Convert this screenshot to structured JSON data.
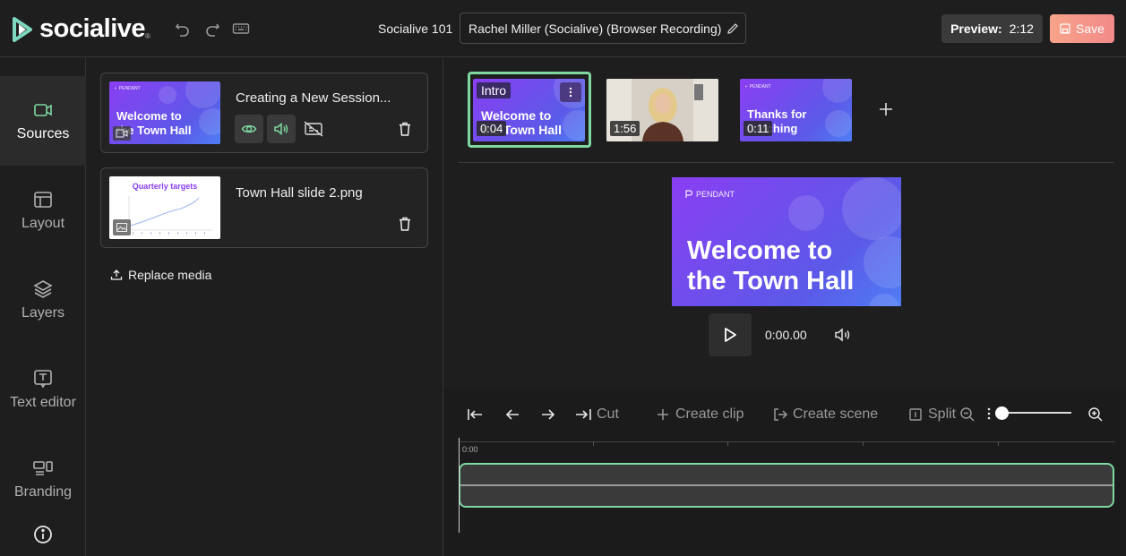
{
  "app": {
    "logo_text": "socialive",
    "logo_tm": "®"
  },
  "header": {
    "session_name": "Socialive 101",
    "recording_title": "Rachel Miller (Socialive) (Browser Recording)",
    "preview_label": "Preview:",
    "preview_time": "2:12",
    "save_label": "Save"
  },
  "sidebar": {
    "items": [
      {
        "label": "Sources",
        "icon": "video-camera-icon",
        "active": true
      },
      {
        "label": "Layout",
        "icon": "layout-icon"
      },
      {
        "label": "Layers",
        "icon": "layers-icon"
      },
      {
        "label": "Text editor",
        "icon": "text-editor-icon"
      },
      {
        "label": "Branding",
        "icon": "branding-icon"
      },
      {
        "label": "",
        "icon": "info-icon"
      }
    ]
  },
  "sources": {
    "items": [
      {
        "title": "Creating a New Session...",
        "thumb_text": "Welcome to the Town Hall",
        "thumb_cut_text": "the Town Hall"
      },
      {
        "title": "Town Hall slide 2.png",
        "thumb_title": "Quarterly targets"
      }
    ],
    "replace_label": "Replace media"
  },
  "scenes": [
    {
      "label": "Intro",
      "duration": "0:04",
      "text_line1": "Welcome to",
      "text_line2": "the Town Hall",
      "selected": true
    },
    {
      "duration": "1:56"
    },
    {
      "duration": "0:11",
      "text_line1": "Thanks for",
      "text_line2": "watching"
    }
  ],
  "preview": {
    "brand": "PENDANT",
    "line1": "Welcome to",
    "line2": "the Town Hall",
    "time": "0:00.00"
  },
  "timeline": {
    "tools": {
      "cut": "Cut",
      "create_clip": "Create clip",
      "create_scene": "Create scene",
      "split": "Split"
    },
    "ruler_start": "0:00",
    "zoom_level": 0.0
  },
  "colors": {
    "accent_green": "#7ed8a0",
    "save_gradient_start": "#f7a38a",
    "save_gradient_end": "#f28a8a",
    "slide_purple": "#8a3ef2",
    "slide_blue": "#4f7ef5"
  }
}
